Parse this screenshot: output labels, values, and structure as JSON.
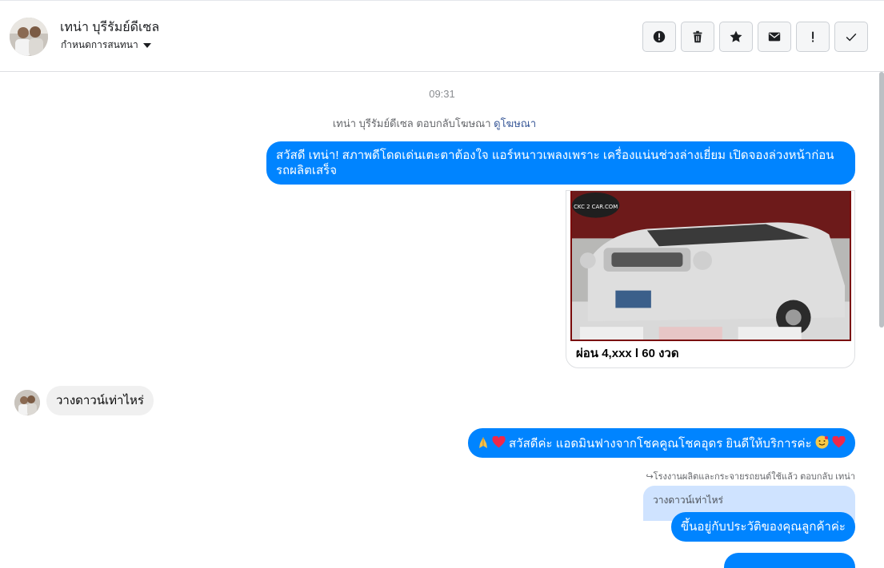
{
  "header": {
    "name": "เทน่า บุรีรัมย์ดีเซล",
    "subtitle": "กำหนดการสนทนา"
  },
  "toolbar": {
    "buttons": [
      {
        "icon": "alert-circle-icon"
      },
      {
        "icon": "trash-icon"
      },
      {
        "icon": "star-icon"
      },
      {
        "icon": "envelope-icon"
      },
      {
        "icon": "exclamation-icon"
      },
      {
        "icon": "check-icon"
      }
    ]
  },
  "conversation": {
    "timestamp": "09:31",
    "ad_reply_text": "เทน่า บุรีรัมย์ดีเซล ตอบกลับโฆษณา",
    "ad_reply_link": "ดูโฆษณา",
    "messages": {
      "greeting": "สวัสดี เทน่า! สภาพดีโดดเด่นเตะตาต้องใจ แอร์หนาวเพลงเพราะ เครื่องแน่นช่วงล่างเยี่ยม เปิดจองล่วงหน้าก่อนรถผลิตเสร็จ",
      "card_caption": "ผ่อน 4,xxx l 60 งวด",
      "card_logo_text": "CKC 2 CAR.COM",
      "customer_question": "วางดาวน์เท่าไหร่",
      "admin_greeting": "สวัสดีค่ะ แอดมินฟางจากโชคคูณโชคอุดร ยินดีให้บริการค่ะ",
      "reply_note": "↪โรงงานผลิตและกระจายรถยนต์ใช้แล้ว ตอบกลับ เทน่า",
      "quoted_text": "วางดาวน์เท่าไหร่",
      "admin_answer": "ขึ้นอยู่กับประวัติของคุณลูกค้าค่ะ"
    }
  },
  "colors": {
    "outgoing_bubble": "#0084ff",
    "incoming_bubble": "#f0f0f0",
    "quoted_bubble": "#cfe3ff",
    "link": "#385898"
  }
}
